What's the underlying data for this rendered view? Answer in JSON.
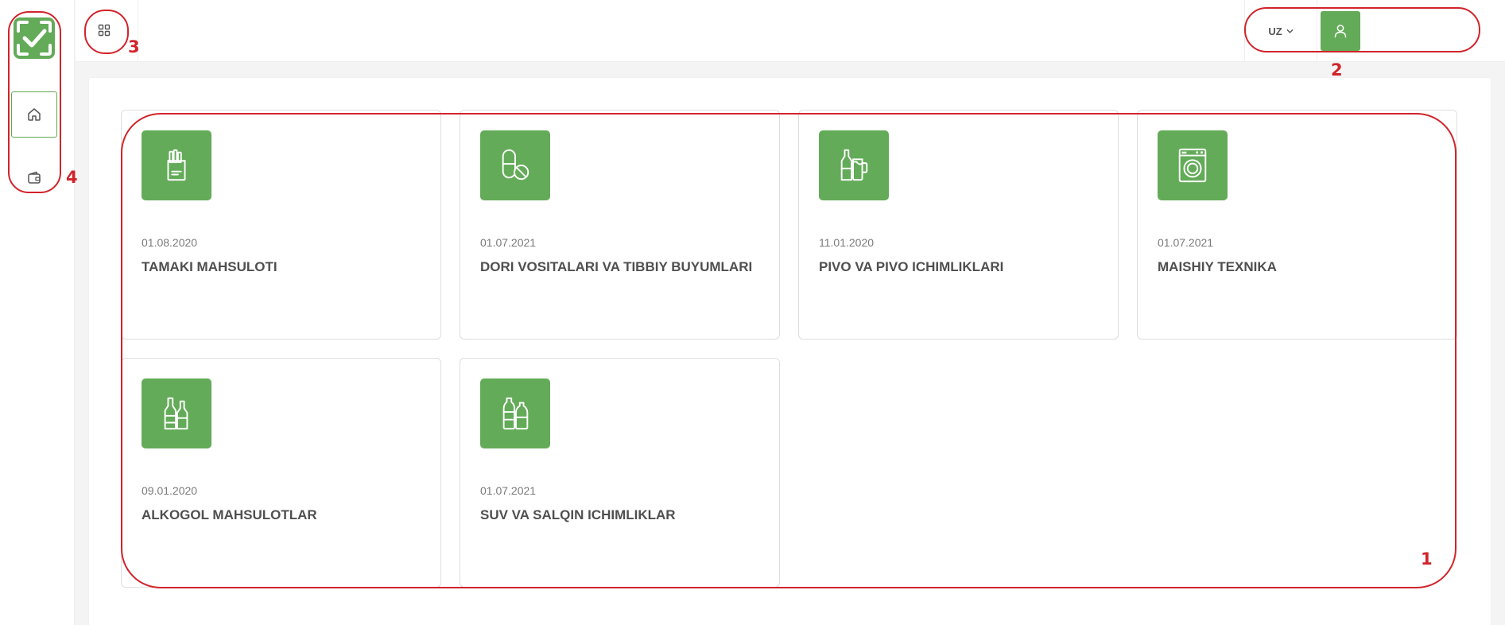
{
  "header": {
    "language": "UZ"
  },
  "sidebar": {
    "items": [
      {
        "icon": "home-icon"
      },
      {
        "icon": "wallet-icon"
      }
    ]
  },
  "cards": [
    {
      "date": "01.08.2020",
      "title": "TAMAKI MAHSULOTI",
      "icon": "cigarette-pack-icon"
    },
    {
      "date": "01.07.2021",
      "title": "DORI VOSITALARI VA TIBBIY BUYUMLARI",
      "icon": "pill-icon"
    },
    {
      "date": "11.01.2020",
      "title": "PIVO VA PIVO ICHIMLIKLARI",
      "icon": "beer-icon"
    },
    {
      "date": "01.07.2021",
      "title": "MAISHIY TEXNIKA",
      "icon": "washing-machine-icon"
    },
    {
      "date": "09.01.2020",
      "title": "ALKOGOL MAHSULOTLAR",
      "icon": "bottles-icon"
    },
    {
      "date": "01.07.2021",
      "title": "SUV VA SALQIN ICHIMLIKLAR",
      "icon": "water-bottles-icon"
    }
  ],
  "annotations": [
    "1",
    "2",
    "3",
    "4"
  ],
  "colors": {
    "accent": "#63ab58",
    "annotation": "#d1232a"
  }
}
